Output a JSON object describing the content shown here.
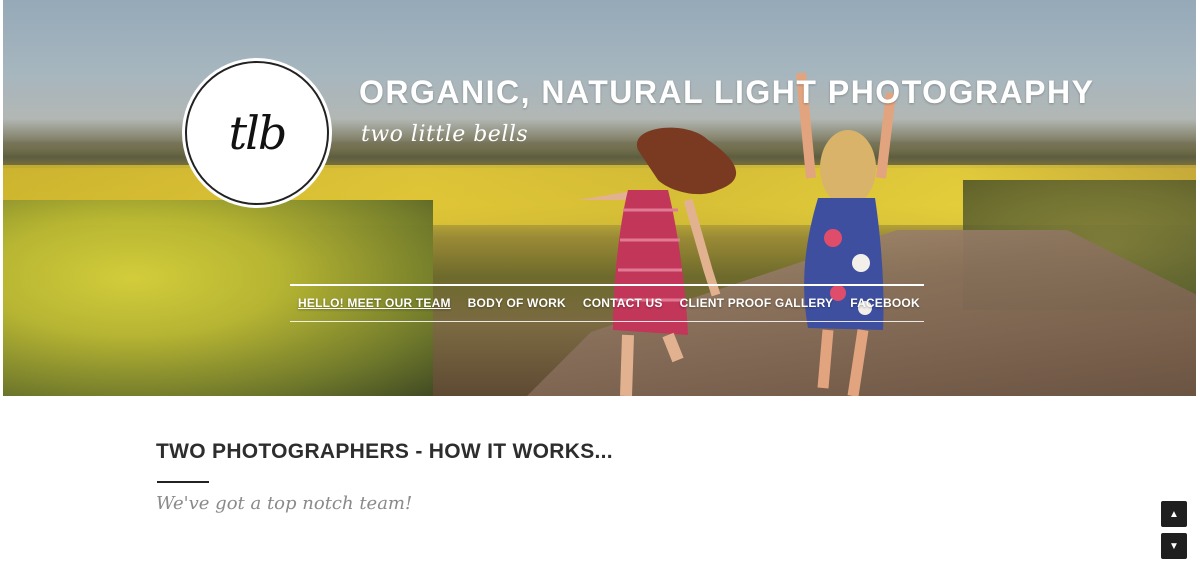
{
  "brand": {
    "logo_text": "tlb",
    "title": "ORGANIC, NATURAL LIGHT PHOTOGRAPHY",
    "tagline": "two little bells"
  },
  "nav": {
    "items": [
      {
        "label": "HELLO! MEET OUR TEAM",
        "active": true
      },
      {
        "label": "BODY OF WORK",
        "active": false
      },
      {
        "label": "CONTACT US",
        "active": false
      },
      {
        "label": "CLIENT PROOF GALLERY",
        "active": false
      },
      {
        "label": "FACEBOOK",
        "active": false
      }
    ]
  },
  "section": {
    "title": "TWO PHOTOGRAPHERS - HOW IT WORKS...",
    "subtitle": "We've got a top notch team!"
  },
  "scroll": {
    "up_icon": "▲",
    "down_icon": "▼"
  },
  "colors": {
    "header_text": "#ffffff",
    "heading": "#2d2d2d",
    "subheading": "#8a8a8a",
    "scroll_button_bg": "#1f1f1f"
  }
}
